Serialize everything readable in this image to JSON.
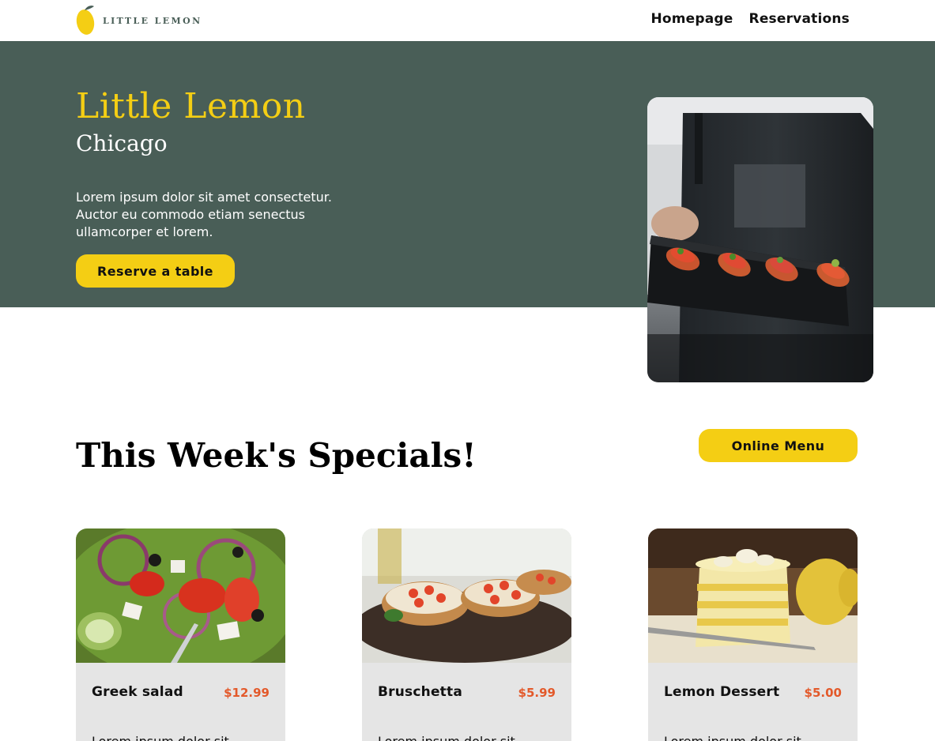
{
  "nav": {
    "logo_text": "LITTLE LEMON",
    "links": [
      "Homepage",
      "Reservations"
    ]
  },
  "hero": {
    "title": "Little Lemon",
    "subtitle": "Chicago",
    "description": "Lorem ipsum dolor sit amet consectetur. Auctor eu commodo etiam senectus ullamcorper et lorem.",
    "cta": "Reserve a table",
    "image_icon": "food-tray-photo"
  },
  "specials": {
    "title": "This Week's Specials!",
    "menu_button": "Online Menu",
    "items": [
      {
        "name": "Greek salad",
        "price": "$12.99",
        "desc": "Lorem ipsum dolor sit",
        "image": "greek-salad-photo"
      },
      {
        "name": "Bruschetta",
        "price": "$5.99",
        "desc": "Lorem ipsum dolor sit",
        "image": "bruschetta-photo"
      },
      {
        "name": "Lemon Dessert",
        "price": "$5.00",
        "desc": "Lorem ipsum dolor sit",
        "image": "lemon-dessert-photo"
      }
    ]
  },
  "colors": {
    "primary_green": "#495E57",
    "primary_yellow": "#F4CE14",
    "price_orange": "#E3592A",
    "card_bg": "#E5E5E5"
  }
}
